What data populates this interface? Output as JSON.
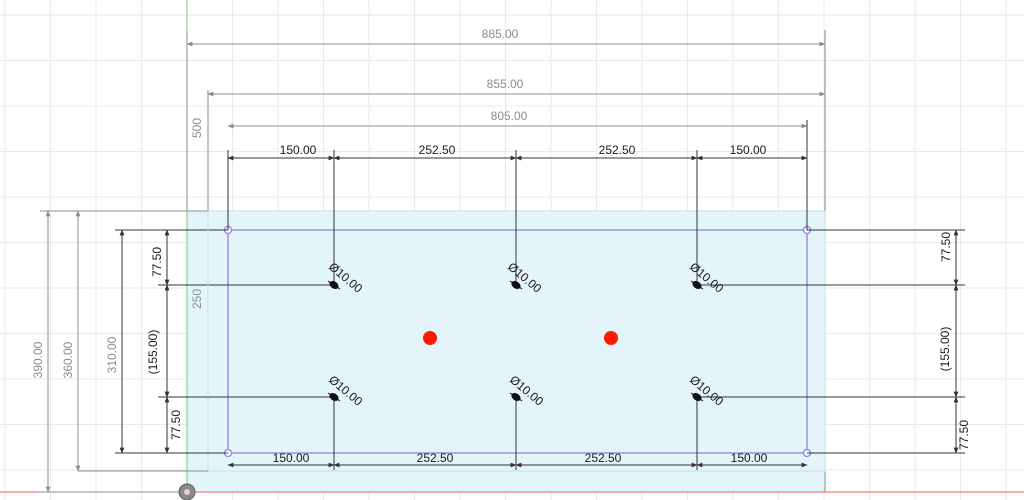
{
  "viewport": {
    "grid_visible": true,
    "colors": {
      "background": "#ffffff",
      "grid": "#e9e9e9",
      "y_axis": "#6fcf6f",
      "x_axis": "#ff5a5a",
      "plate_fill": "#e4f4fb",
      "sketch_line": "#9a90e0",
      "outer_body": "#7d9a9a",
      "dimension_black": "#1a1a1a",
      "dimension_gray": "#8c8c8c",
      "hole_center": "#ff1a00"
    }
  },
  "dimensions": {
    "overall_885": "885.00",
    "overall_855": "855.00",
    "overall_805": "805.00",
    "vertical_500": "500",
    "top_segments": [
      "150.00",
      "252.50",
      "252.50",
      "150.00"
    ],
    "bottom_segments": [
      "150.00",
      "252.50",
      "252.50",
      "150.00"
    ],
    "left_outer_390": "390.00",
    "left_outer_360": "360.00",
    "left_outer_310": "310.00",
    "left_top_offset": "77.50",
    "left_middle_ref": "(155.00)",
    "left_bottom_offset": "77.50",
    "inner_height_250": "250",
    "right_top_offset": "77.50",
    "right_middle_ref": "(155.00)",
    "right_bottom_offset": "77.50",
    "hole_diameter": "Ø10.00"
  },
  "holes": {
    "count": 6,
    "label": "Ø10.00"
  },
  "center_points": {
    "count": 2
  },
  "origin_icon": "origin-icon"
}
